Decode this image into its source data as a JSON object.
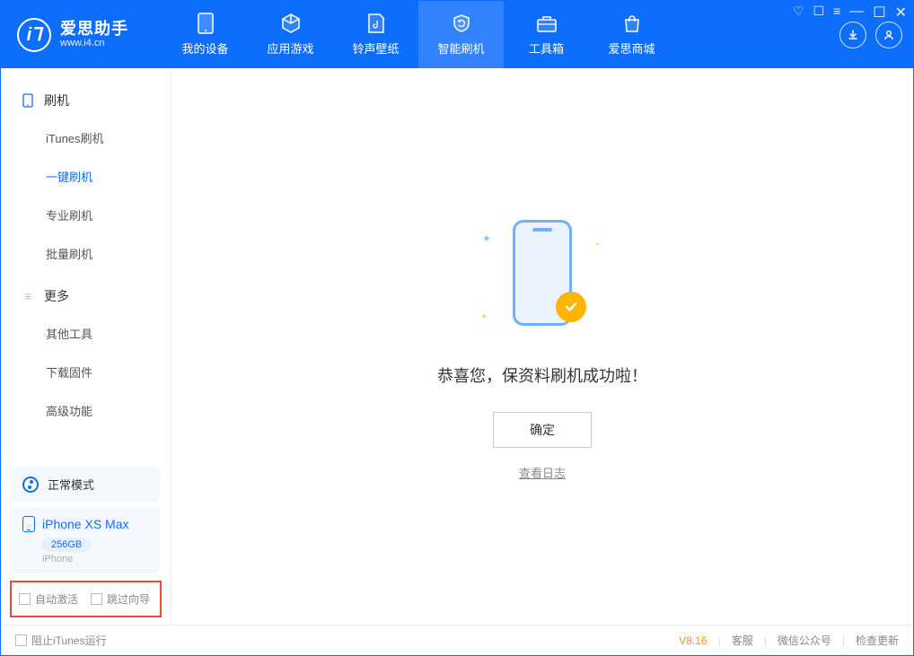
{
  "app": {
    "name": "爱思助手",
    "site": "www.i4.cn"
  },
  "nav": {
    "items": [
      {
        "label": "我的设备"
      },
      {
        "label": "应用游戏"
      },
      {
        "label": "铃声壁纸"
      },
      {
        "label": "智能刷机"
      },
      {
        "label": "工具箱"
      },
      {
        "label": "爱思商城"
      }
    ],
    "active_index": 3
  },
  "sidebar": {
    "section1": {
      "title": "刷机",
      "items": [
        {
          "label": "iTunes刷机"
        },
        {
          "label": "一键刷机"
        },
        {
          "label": "专业刷机"
        },
        {
          "label": "批量刷机"
        }
      ],
      "active_index": 1
    },
    "section2": {
      "title": "更多",
      "items": [
        {
          "label": "其他工具"
        },
        {
          "label": "下载固件"
        },
        {
          "label": "高级功能"
        }
      ]
    },
    "mode": {
      "label": "正常模式"
    },
    "device": {
      "name": "iPhone XS Max",
      "storage": "256GB",
      "type": "iPhone"
    },
    "checkboxes": {
      "auto_activate": "自动激活",
      "skip_guide": "跳过向导"
    }
  },
  "content": {
    "success_text": "恭喜您，保资料刷机成功啦！",
    "ok_label": "确定",
    "log_link": "查看日志"
  },
  "statusbar": {
    "block_itunes": "阻止iTunes运行",
    "version": "V8.16",
    "links": {
      "service": "客服",
      "wechat": "微信公众号",
      "update": "检查更新"
    }
  }
}
